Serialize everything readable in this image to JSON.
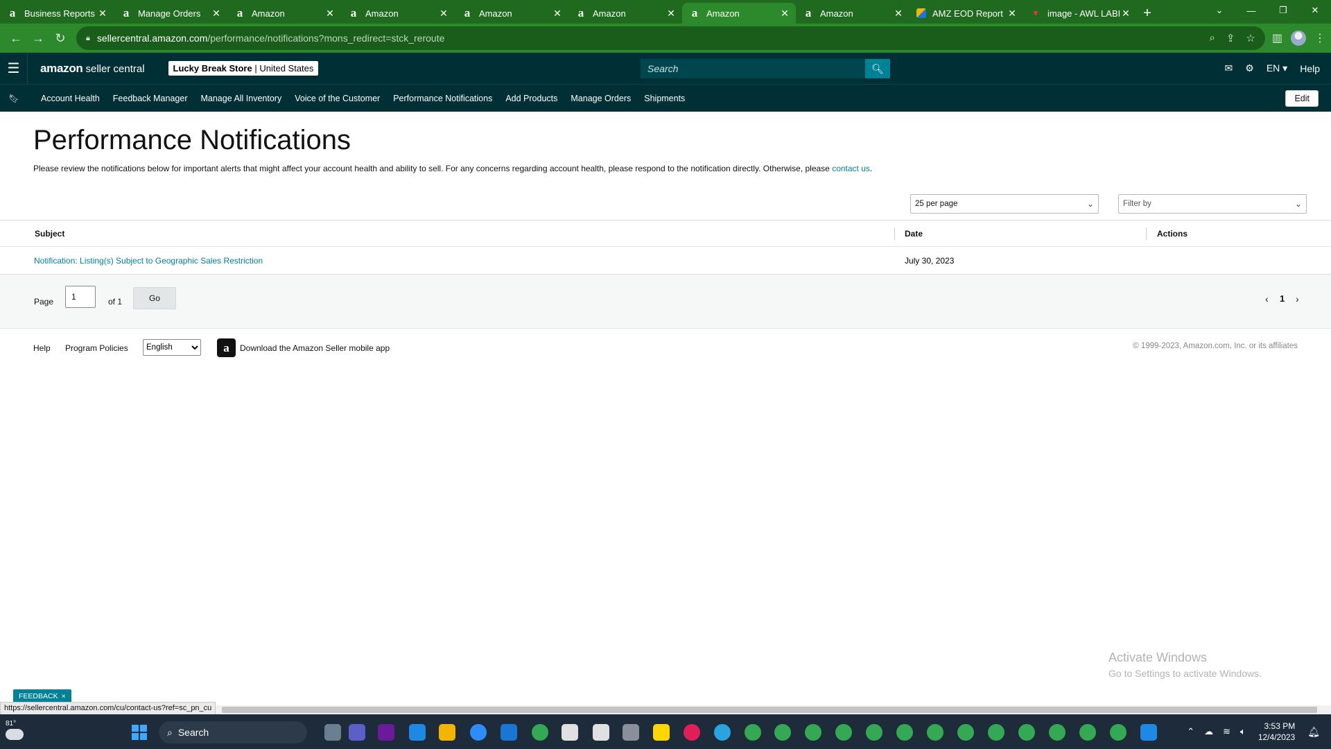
{
  "browser": {
    "tabs": [
      {
        "label": "Business Reports",
        "favicon": "amazon-icon",
        "active": false
      },
      {
        "label": "Manage Orders",
        "favicon": "amazon-icon",
        "active": false
      },
      {
        "label": "Amazon",
        "favicon": "amazon-icon",
        "active": false
      },
      {
        "label": "Amazon",
        "favicon": "amazon-icon",
        "active": false
      },
      {
        "label": "Amazon",
        "favicon": "amazon-icon",
        "active": false
      },
      {
        "label": "Amazon",
        "favicon": "amazon-icon",
        "active": false
      },
      {
        "label": "Amazon",
        "favicon": "amazon-icon",
        "active": true
      },
      {
        "label": "Amazon",
        "favicon": "amazon-icon",
        "active": false
      },
      {
        "label": "AMZ EOD Report",
        "favicon": "sheet-icon",
        "active": false
      },
      {
        "label": "image - AWL LABI",
        "favicon": "image-icon",
        "active": false
      }
    ],
    "url_host": "sellercentral.amazon.com",
    "url_path": "/performance/notifications?mons_redirect=stck_reroute",
    "theme_color": "#2c8a2c"
  },
  "header": {
    "logo_brand": "amazon",
    "logo_product": "seller central",
    "store_name": "Lucky Break Store",
    "store_separator": "|",
    "store_region": "United States",
    "search_placeholder": "Search",
    "language": "EN",
    "help": "Help"
  },
  "nav": {
    "items": [
      "Account Health",
      "Feedback Manager",
      "Manage All Inventory",
      "Voice of the Customer",
      "Performance Notifications",
      "Add Products",
      "Manage Orders",
      "Shipments"
    ],
    "edit_label": "Edit"
  },
  "page": {
    "title": "Performance Notifications",
    "intro": "Please review the notifications below for important alerts that might affect your account health and ability to sell. For any concerns regarding account health, please respond to the notification directly. Otherwise, please ",
    "intro_link": "contact us",
    "intro_end": ".",
    "per_page": "25 per page",
    "filter_placeholder": "Filter by",
    "columns": {
      "subject": "Subject",
      "date": "Date",
      "actions": "Actions"
    },
    "rows": [
      {
        "subject": "Notification: Listing(s) Subject to Geographic Sales Restriction",
        "date": "July 30, 2023",
        "actions": ""
      }
    ]
  },
  "pager": {
    "page_label": "Page",
    "page_value": "1",
    "of_label": "of 1",
    "go_label": "Go",
    "current_page": "1"
  },
  "footer": {
    "help": "Help",
    "program_policies": "Program Policies",
    "language": "English",
    "app_text": "Download the Amazon Seller mobile app",
    "copyright": "© 1999-2023, Amazon.com, Inc. or its affiliates"
  },
  "watermark": {
    "line1": "Activate Windows",
    "line2": "Go to Settings to activate Windows."
  },
  "feedback": {
    "label": "FEEDBACK",
    "close": "×"
  },
  "status_url": "https://sellercentral.amazon.com/cu/contact-us?ref=sc_pn_cu",
  "taskbar": {
    "temperature": "81°",
    "search": "Search",
    "time": "3:53 PM",
    "date": "12/4/2023"
  }
}
